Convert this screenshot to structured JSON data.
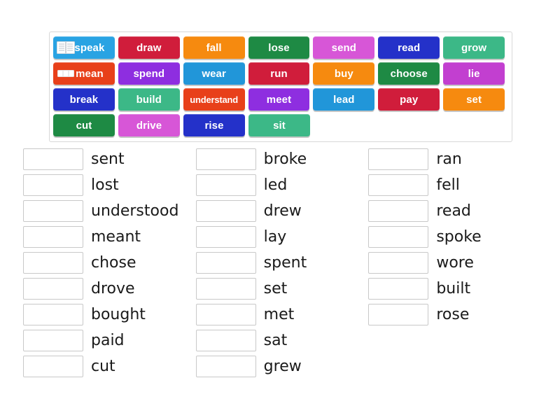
{
  "tile_bank": {
    "name": "word-tile-bank",
    "rows": [
      [
        {
          "label": "speak",
          "color": "#29a3e3",
          "icon": "book-pages-icon"
        },
        {
          "label": "draw",
          "color": "#d01d3b",
          "icon": null
        },
        {
          "label": "fall",
          "color": "#f68a0f",
          "icon": null
        },
        {
          "label": "lose",
          "color": "#1e8a44",
          "icon": null
        },
        {
          "label": "send",
          "color": "#d756d7",
          "icon": null
        },
        {
          "label": "read",
          "color": "#2431c9",
          "icon": null
        },
        {
          "label": "grow",
          "color": "#3cb887",
          "icon": null
        }
      ],
      [
        {
          "label": "mean",
          "color": "#e8401a",
          "icon": "card-icon"
        },
        {
          "label": "spend",
          "color": "#8e2ee0",
          "icon": null
        },
        {
          "label": "wear",
          "color": "#2196d9",
          "icon": null
        },
        {
          "label": "run",
          "color": "#d01d3b",
          "icon": null
        },
        {
          "label": "buy",
          "color": "#f68a0f",
          "icon": null
        },
        {
          "label": "choose",
          "color": "#1e8a44",
          "icon": null
        },
        {
          "label": "lie",
          "color": "#c23fd0",
          "icon": null
        }
      ],
      [
        {
          "label": "break",
          "color": "#2431c9",
          "icon": null
        },
        {
          "label": "build",
          "color": "#3cb887",
          "icon": null
        },
        {
          "label": "understand",
          "color": "#e8401a",
          "icon": null,
          "tight": true
        },
        {
          "label": "meet",
          "color": "#8e2ee0",
          "icon": null
        },
        {
          "label": "lead",
          "color": "#2196d9",
          "icon": null
        },
        {
          "label": "pay",
          "color": "#d01d3b",
          "icon": null
        },
        {
          "label": "set",
          "color": "#f68a0f",
          "icon": null
        }
      ],
      [
        {
          "label": "cut",
          "color": "#1e8a44",
          "icon": null
        },
        {
          "label": "drive",
          "color": "#d756d7",
          "icon": null
        },
        {
          "label": "rise",
          "color": "#2431c9",
          "icon": null
        },
        {
          "label": "sit",
          "color": "#3cb887",
          "icon": null
        }
      ]
    ]
  },
  "answers": {
    "name": "answer-columns",
    "columns": [
      {
        "items": [
          {
            "box_value": "",
            "word": "sent"
          },
          {
            "box_value": "",
            "word": "lost"
          },
          {
            "box_value": "",
            "word": "understood"
          },
          {
            "box_value": "",
            "word": "meant"
          },
          {
            "box_value": "",
            "word": "chose"
          },
          {
            "box_value": "",
            "word": "drove"
          },
          {
            "box_value": "",
            "word": "bought"
          },
          {
            "box_value": "",
            "word": "paid"
          },
          {
            "box_value": "",
            "word": "cut"
          }
        ]
      },
      {
        "items": [
          {
            "box_value": "",
            "word": "broke"
          },
          {
            "box_value": "",
            "word": "led"
          },
          {
            "box_value": "",
            "word": "drew"
          },
          {
            "box_value": "",
            "word": "lay"
          },
          {
            "box_value": "",
            "word": "spent"
          },
          {
            "box_value": "",
            "word": "set"
          },
          {
            "box_value": "",
            "word": "met"
          },
          {
            "box_value": "",
            "word": "sat"
          },
          {
            "box_value": "",
            "word": "grew"
          }
        ]
      },
      {
        "items": [
          {
            "box_value": "",
            "word": "ran"
          },
          {
            "box_value": "",
            "word": "fell"
          },
          {
            "box_value": "",
            "word": "read"
          },
          {
            "box_value": "",
            "word": "spoke"
          },
          {
            "box_value": "",
            "word": "wore"
          },
          {
            "box_value": "",
            "word": "built"
          },
          {
            "box_value": "",
            "word": "rose"
          }
        ]
      }
    ]
  }
}
